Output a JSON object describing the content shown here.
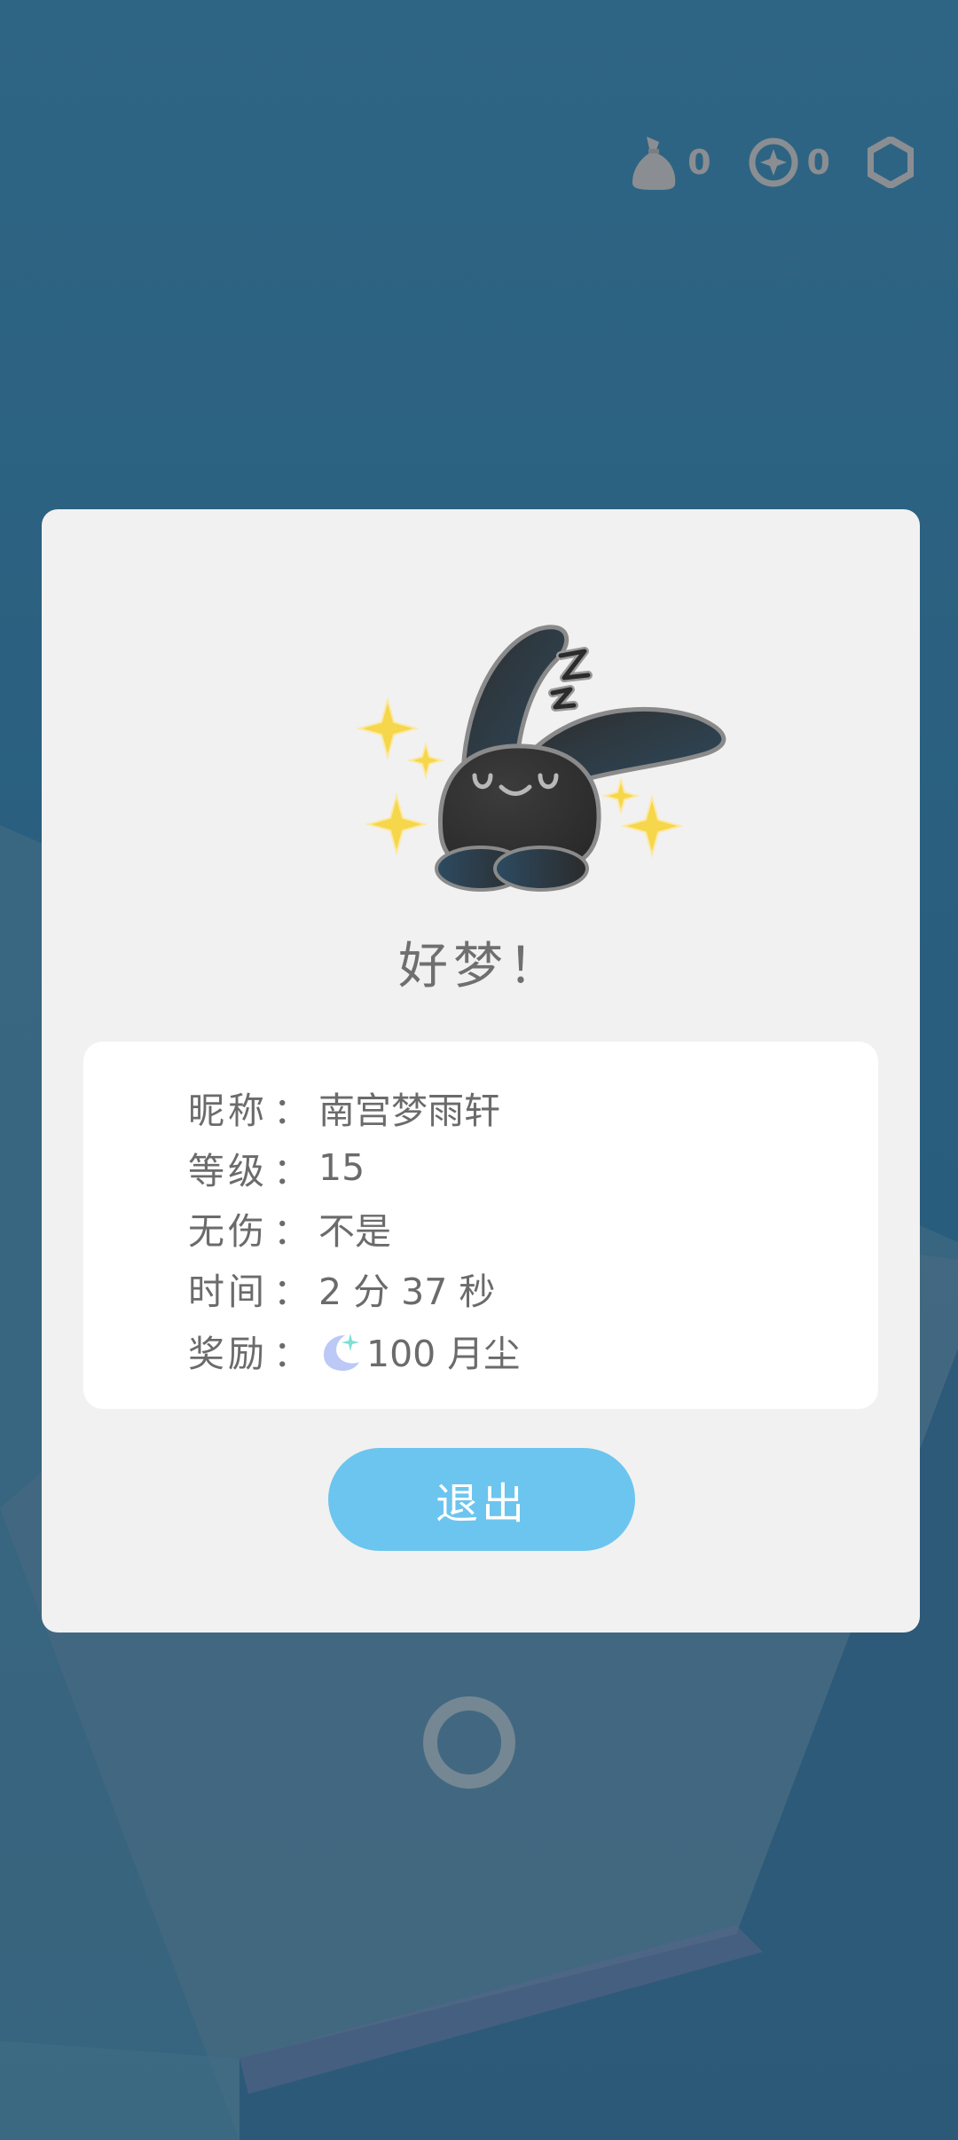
{
  "hud": {
    "bag_count": "0",
    "coin_count": "0"
  },
  "dialog": {
    "title": "好梦！",
    "rows": [
      {
        "label": "昵称",
        "sep": "：",
        "value": "南宫梦雨轩"
      },
      {
        "label": "等级",
        "sep": "：",
        "value": "15"
      },
      {
        "label": "无伤",
        "sep": "：",
        "value": "不是"
      },
      {
        "label": "时间",
        "sep": "：",
        "value": "2 分 37 秒"
      },
      {
        "label": "奖励",
        "sep": "：",
        "value": "100 月尘"
      }
    ],
    "exit_label": "退出"
  },
  "colors": {
    "background": "#2a5f7f",
    "dialog": "#f1f1f1",
    "button": "#6cc5ee",
    "text": "#6b6b6b"
  },
  "icons": {
    "hud": [
      "bag-icon",
      "coin-icon",
      "settings-hexagon-icon"
    ],
    "reward": "moon-dust-icon"
  }
}
